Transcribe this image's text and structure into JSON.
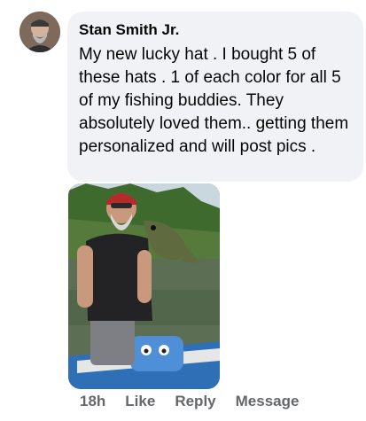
{
  "comment": {
    "author": "Stan Smith Jr.",
    "text": "My new lucky hat .  I bought 5 of these hats . 1 of each color for all 5 of my fishing buddies. They absolutely loved them.. getting them personalized and will post pics .",
    "photo_icon": "fishing-photo",
    "avatar_icon": "user-avatar"
  },
  "actions": {
    "time": "18h",
    "like": "Like",
    "reply": "Reply",
    "message": "Message"
  }
}
